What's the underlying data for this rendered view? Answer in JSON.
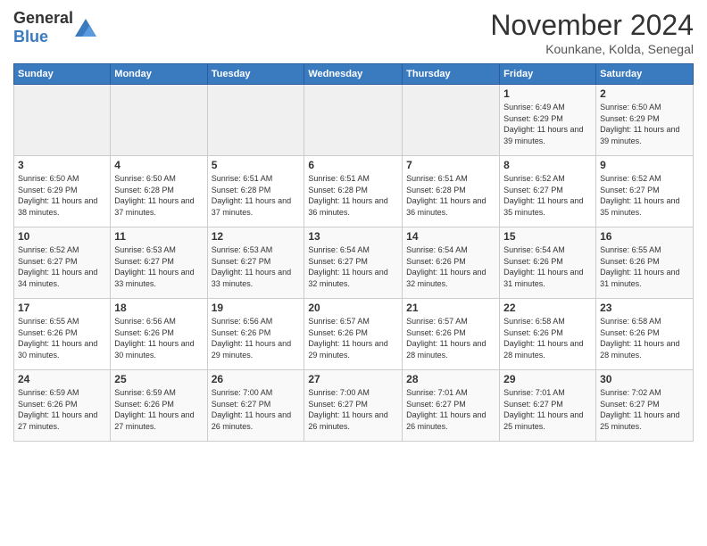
{
  "logo": {
    "general": "General",
    "blue": "Blue"
  },
  "header": {
    "month": "November 2024",
    "location": "Kounkane, Kolda, Senegal"
  },
  "weekdays": [
    "Sunday",
    "Monday",
    "Tuesday",
    "Wednesday",
    "Thursday",
    "Friday",
    "Saturday"
  ],
  "weeks": [
    [
      {
        "day": "",
        "info": ""
      },
      {
        "day": "",
        "info": ""
      },
      {
        "day": "",
        "info": ""
      },
      {
        "day": "",
        "info": ""
      },
      {
        "day": "",
        "info": ""
      },
      {
        "day": "1",
        "info": "Sunrise: 6:49 AM\nSunset: 6:29 PM\nDaylight: 11 hours and 39 minutes."
      },
      {
        "day": "2",
        "info": "Sunrise: 6:50 AM\nSunset: 6:29 PM\nDaylight: 11 hours and 39 minutes."
      }
    ],
    [
      {
        "day": "3",
        "info": "Sunrise: 6:50 AM\nSunset: 6:29 PM\nDaylight: 11 hours and 38 minutes."
      },
      {
        "day": "4",
        "info": "Sunrise: 6:50 AM\nSunset: 6:28 PM\nDaylight: 11 hours and 37 minutes."
      },
      {
        "day": "5",
        "info": "Sunrise: 6:51 AM\nSunset: 6:28 PM\nDaylight: 11 hours and 37 minutes."
      },
      {
        "day": "6",
        "info": "Sunrise: 6:51 AM\nSunset: 6:28 PM\nDaylight: 11 hours and 36 minutes."
      },
      {
        "day": "7",
        "info": "Sunrise: 6:51 AM\nSunset: 6:28 PM\nDaylight: 11 hours and 36 minutes."
      },
      {
        "day": "8",
        "info": "Sunrise: 6:52 AM\nSunset: 6:27 PM\nDaylight: 11 hours and 35 minutes."
      },
      {
        "day": "9",
        "info": "Sunrise: 6:52 AM\nSunset: 6:27 PM\nDaylight: 11 hours and 35 minutes."
      }
    ],
    [
      {
        "day": "10",
        "info": "Sunrise: 6:52 AM\nSunset: 6:27 PM\nDaylight: 11 hours and 34 minutes."
      },
      {
        "day": "11",
        "info": "Sunrise: 6:53 AM\nSunset: 6:27 PM\nDaylight: 11 hours and 33 minutes."
      },
      {
        "day": "12",
        "info": "Sunrise: 6:53 AM\nSunset: 6:27 PM\nDaylight: 11 hours and 33 minutes."
      },
      {
        "day": "13",
        "info": "Sunrise: 6:54 AM\nSunset: 6:27 PM\nDaylight: 11 hours and 32 minutes."
      },
      {
        "day": "14",
        "info": "Sunrise: 6:54 AM\nSunset: 6:26 PM\nDaylight: 11 hours and 32 minutes."
      },
      {
        "day": "15",
        "info": "Sunrise: 6:54 AM\nSunset: 6:26 PM\nDaylight: 11 hours and 31 minutes."
      },
      {
        "day": "16",
        "info": "Sunrise: 6:55 AM\nSunset: 6:26 PM\nDaylight: 11 hours and 31 minutes."
      }
    ],
    [
      {
        "day": "17",
        "info": "Sunrise: 6:55 AM\nSunset: 6:26 PM\nDaylight: 11 hours and 30 minutes."
      },
      {
        "day": "18",
        "info": "Sunrise: 6:56 AM\nSunset: 6:26 PM\nDaylight: 11 hours and 30 minutes."
      },
      {
        "day": "19",
        "info": "Sunrise: 6:56 AM\nSunset: 6:26 PM\nDaylight: 11 hours and 29 minutes."
      },
      {
        "day": "20",
        "info": "Sunrise: 6:57 AM\nSunset: 6:26 PM\nDaylight: 11 hours and 29 minutes."
      },
      {
        "day": "21",
        "info": "Sunrise: 6:57 AM\nSunset: 6:26 PM\nDaylight: 11 hours and 28 minutes."
      },
      {
        "day": "22",
        "info": "Sunrise: 6:58 AM\nSunset: 6:26 PM\nDaylight: 11 hours and 28 minutes."
      },
      {
        "day": "23",
        "info": "Sunrise: 6:58 AM\nSunset: 6:26 PM\nDaylight: 11 hours and 28 minutes."
      }
    ],
    [
      {
        "day": "24",
        "info": "Sunrise: 6:59 AM\nSunset: 6:26 PM\nDaylight: 11 hours and 27 minutes."
      },
      {
        "day": "25",
        "info": "Sunrise: 6:59 AM\nSunset: 6:26 PM\nDaylight: 11 hours and 27 minutes."
      },
      {
        "day": "26",
        "info": "Sunrise: 7:00 AM\nSunset: 6:27 PM\nDaylight: 11 hours and 26 minutes."
      },
      {
        "day": "27",
        "info": "Sunrise: 7:00 AM\nSunset: 6:27 PM\nDaylight: 11 hours and 26 minutes."
      },
      {
        "day": "28",
        "info": "Sunrise: 7:01 AM\nSunset: 6:27 PM\nDaylight: 11 hours and 26 minutes."
      },
      {
        "day": "29",
        "info": "Sunrise: 7:01 AM\nSunset: 6:27 PM\nDaylight: 11 hours and 25 minutes."
      },
      {
        "day": "30",
        "info": "Sunrise: 7:02 AM\nSunset: 6:27 PM\nDaylight: 11 hours and 25 minutes."
      }
    ]
  ]
}
